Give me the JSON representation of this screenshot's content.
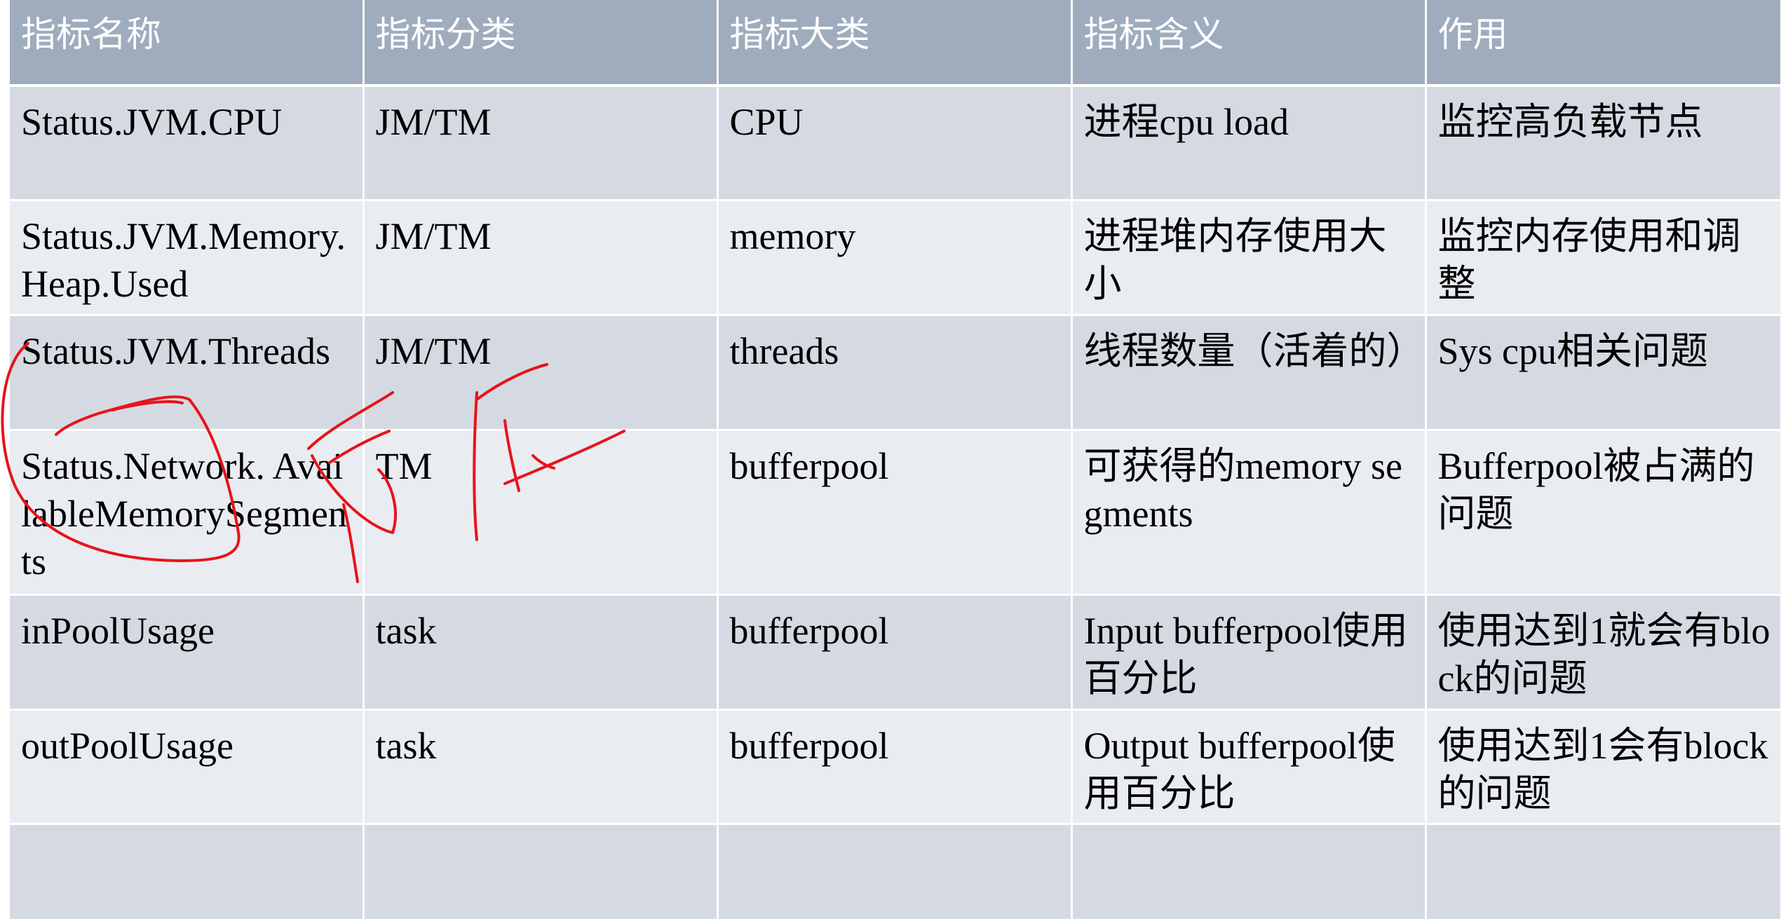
{
  "table": {
    "headers": [
      "指标名称",
      "指标分类",
      "指标大类",
      "指标含义",
      "作用"
    ],
    "rows": [
      [
        "Status.JVM.CPU",
        "JM/TM",
        "CPU",
        "进程cpu load",
        "监控高负载节点"
      ],
      [
        "Status.JVM.Memory. Heap.Used",
        "JM/TM",
        "memory",
        "进程堆内存使用大小",
        "监控内存使用和调整"
      ],
      [
        "Status.JVM.Threads",
        "JM/TM",
        "threads",
        "线程数量（活着的）",
        "Sys cpu相关问题"
      ],
      [
        "Status.Network. AvailableMemorySegments",
        "TM",
        "bufferpool",
        "可获得的memory segments",
        "Bufferpool被占满的问题"
      ],
      [
        "inPoolUsage",
        "task",
        "bufferpool",
        "Input bufferpool使用百分比",
        "使用达到1就会有block的问题"
      ],
      [
        "outPoolUsage",
        "task",
        "bufferpool",
        "Output bufferpool使用百分比",
        "使用达到1会有block的问题"
      ],
      [
        "",
        "",
        "",
        "",
        ""
      ]
    ]
  },
  "colors": {
    "header_bg": "#9eacbd",
    "row_odd_bg": "#d5dae2",
    "row_even_bg": "#e9ecf1",
    "annotation_ink": "#e8131b"
  }
}
